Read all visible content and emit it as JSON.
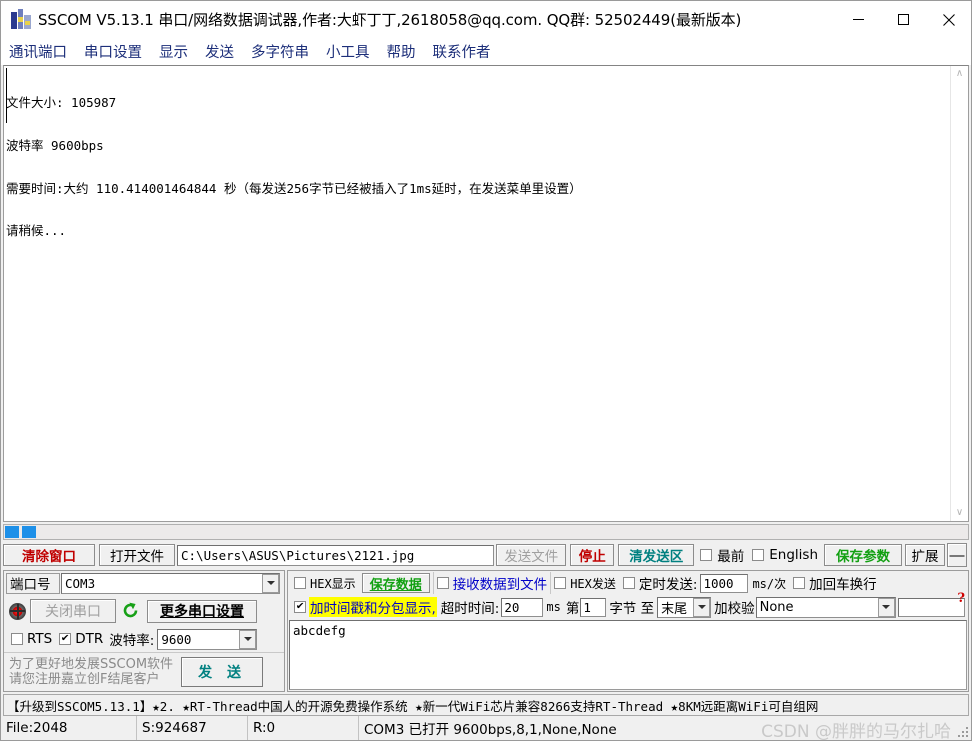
{
  "window": {
    "title": "SSCOM V5.13.1 串口/网络数据调试器,作者:大虾丁丁,2618058@qq.com. QQ群: 52502449(最新版本)",
    "minimize_label": "—",
    "maximize_label": "□",
    "close_label": "✕"
  },
  "menu": {
    "items": [
      {
        "label": "通讯端口"
      },
      {
        "label": "串口设置"
      },
      {
        "label": "显示"
      },
      {
        "label": "发送"
      },
      {
        "label": "多字符串"
      },
      {
        "label": "小工具"
      },
      {
        "label": "帮助"
      },
      {
        "label": "联系作者"
      }
    ]
  },
  "receive": {
    "lines": [
      "文件大小: 105987",
      "波特率 9600bps",
      "需要时间:大约 110.414001464844 秒（每发送256字节已经被插入了1ms延时，在发送菜单里设置）",
      "请稍候..."
    ],
    "scroll_up": "∧",
    "scroll_down": "∨"
  },
  "file_row": {
    "clear_window": "清除窗口",
    "open_file": "打开文件",
    "file_path": "C:\\Users\\ASUS\\Pictures\\2121.jpg",
    "send_file": "发送文件",
    "stop": "停止",
    "clear_send": "清发送区",
    "topmost_label": "最前",
    "topmost_checked": false,
    "english_label": "English",
    "english_checked": false,
    "save_params": "保存参数",
    "extend": "扩展",
    "minus": "—"
  },
  "port_panel": {
    "port_label": "端口号",
    "port_value": "COM3",
    "close_port": "关闭串口",
    "more_settings": "更多串口设置",
    "rts_label": "RTS",
    "rts_checked": false,
    "dtr_label": "DTR",
    "dtr_checked": true,
    "baud_label": "波特率:",
    "baud_value": "9600",
    "register_note_line1": "为了更好地发展SSCOM软件",
    "register_note_line2": "请您注册嘉立创F结尾客户",
    "send_button": "发 送"
  },
  "options": {
    "hex_display_label": "HEX显示",
    "hex_display_checked": false,
    "save_data": "保存数据",
    "recv_to_file_label": "接收数据到文件",
    "recv_to_file_checked": false,
    "hex_send_label": "HEX发送",
    "hex_send_checked": false,
    "timed_send_label": "定时发送:",
    "timed_send_checked": false,
    "timed_send_value": "1000",
    "ms_per_time": "ms/次",
    "crlf_label": "加回车换行",
    "crlf_checked": false,
    "timestamp_label": "加时间戳和分包显示,",
    "timestamp_checked": true,
    "timeout_label": "超时时间:",
    "timeout_value": "20",
    "ms_unit": "ms",
    "byte_from_label": "第",
    "byte_from_value": "1",
    "byte_label": "字节 至",
    "byte_to_value": "末尾",
    "checksum_label": "加校验",
    "checksum_value": "None",
    "checksum_extra": "",
    "help_mark": "?"
  },
  "send_area": {
    "text": "abcdefg"
  },
  "adbar": {
    "text": "【升级到SSCOM5.13.1】★2.  ★RT-Thread中国人的开源免费操作系统 ★新一代WiFi芯片兼容8266支持RT-Thread ★8KM远距离WiFi可自组网"
  },
  "statusbar": {
    "file": "File:2048",
    "sent": "S:924687",
    "recv": "R:0",
    "connection": "COM3 已打开  9600bps,8,1,None,None",
    "watermark": "CSDN @胖胖的马尔扎哈"
  },
  "colors": {
    "accent_blue": "#1e90e8",
    "menu_blue": "#1d2f7a",
    "red": "#c00000",
    "teal": "#008080",
    "green": "#12a012",
    "highlight_yellow": "#ffff00"
  }
}
